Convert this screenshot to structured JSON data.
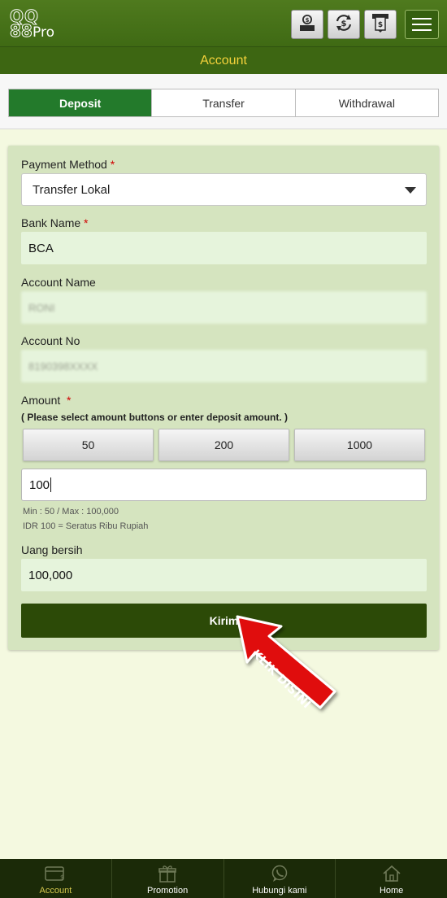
{
  "header": {
    "logo_line1": "QQ",
    "logo_line2": "88",
    "logo_line3": "Pro",
    "icons": [
      "deposit-icon",
      "transfer-icon",
      "withdraw-icon",
      "menu-icon"
    ]
  },
  "page_title": "Account",
  "tabs": [
    {
      "label": "Deposit",
      "active": true
    },
    {
      "label": "Transfer",
      "active": false
    },
    {
      "label": "Withdrawal",
      "active": false
    }
  ],
  "form": {
    "payment_method_label": "Payment Method",
    "payment_method_value": "Transfer Lokal",
    "bank_name_label": "Bank Name",
    "bank_name_value": "BCA",
    "account_name_label": "Account Name",
    "account_name_value": "RONI",
    "account_no_label": "Account No",
    "account_no_value": "8190398XXXX",
    "amount_label": "Amount",
    "amount_hint": "( Please select amount buttons or enter deposit amount. )",
    "amount_buttons": [
      "50",
      "200",
      "1000"
    ],
    "amount_value": "100",
    "min_max": "Min : 50 / Max : 100,000",
    "idr_text": "IDR 100 = Seratus Ribu Rupiah",
    "net_label": "Uang bersih",
    "net_value": "100,000",
    "submit_label": "Kirim",
    "required_mark": "*"
  },
  "annotation": {
    "text": "KLIK DISINI",
    "color": "#e01010"
  },
  "bottom_nav": [
    {
      "label": "Account",
      "icon": "wallet-icon",
      "active": true
    },
    {
      "label": "Promotion",
      "icon": "gift-icon",
      "active": false
    },
    {
      "label": "Hubungi kami",
      "icon": "whatsapp-icon",
      "active": false
    },
    {
      "label": "Home",
      "icon": "home-icon",
      "active": false
    }
  ],
  "colors": {
    "header_green": "#4f7a1e",
    "title_text": "#f4d23b",
    "active_tab": "#237a2b",
    "submit": "#2c4a07",
    "nav_bg": "#1b2a08"
  }
}
